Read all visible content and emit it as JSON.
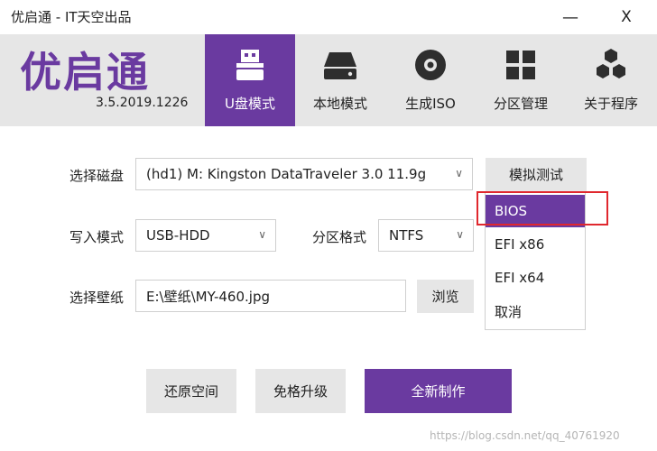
{
  "window": {
    "title": "优启通 - IT天空出品",
    "minimize": "—",
    "close": "X"
  },
  "header": {
    "logo": "优启通",
    "version": "3.5.2019.1226",
    "nav": [
      {
        "label": "U盘模式",
        "icon": "usb-drive-icon",
        "active": true
      },
      {
        "label": "本地模式",
        "icon": "hard-disk-icon",
        "active": false
      },
      {
        "label": "生成ISO",
        "icon": "disc-icon",
        "active": false
      },
      {
        "label": "分区管理",
        "icon": "partition-grid-icon",
        "active": false
      },
      {
        "label": "关于程序",
        "icon": "hexagons-icon",
        "active": false
      }
    ]
  },
  "form": {
    "disk_label": "选择磁盘",
    "disk_value": "(hd1) M: Kingston DataTraveler 3.0 11.9g",
    "simulate_button": "模拟测试",
    "write_mode_label": "写入模式",
    "write_mode_value": "USB-HDD",
    "partition_label": "分区格式",
    "partition_value": "NTFS",
    "wallpaper_label": "选择壁纸",
    "wallpaper_value": "E:\\壁纸\\MY-460.jpg",
    "browse_button": "浏览",
    "chevron": "∨"
  },
  "dropdown_menu": {
    "items": [
      "BIOS",
      "EFI x86",
      "EFI x64",
      "取消"
    ]
  },
  "actions": {
    "restore": "还原空间",
    "upgrade": "免格升级",
    "create": "全新制作"
  },
  "watermark": "https://blog.csdn.net/qq_40761920",
  "colors": {
    "accent": "#6a3aa0",
    "header_bg": "#e6e6e6",
    "highlight": "#e0282e"
  }
}
